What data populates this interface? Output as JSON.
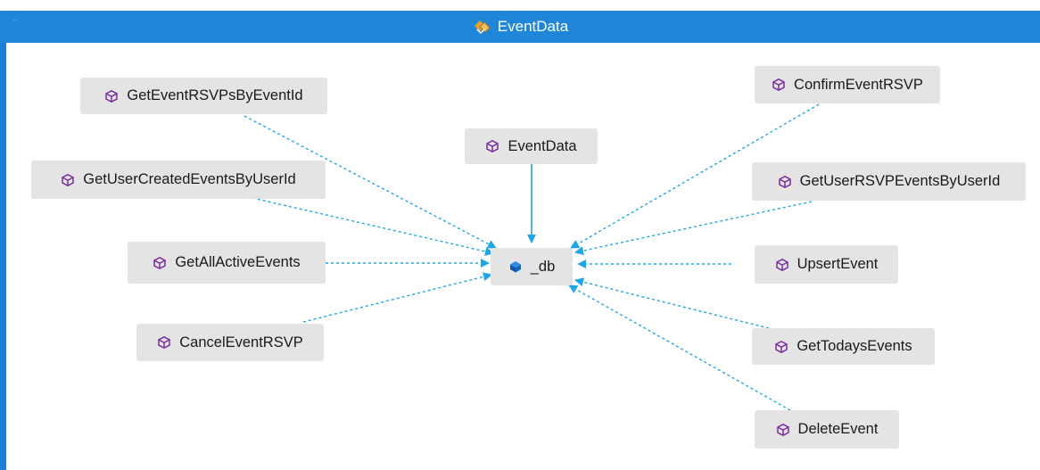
{
  "window": {
    "title": "EventData",
    "icon": "class-diagram-icon"
  },
  "colors": {
    "accent": "#1f86d8",
    "edge": "#1ea7e6",
    "node_fill": "#e4e4e4",
    "method_icon": "#7a2ea0",
    "field_icon": "#1466b8"
  },
  "center_node": {
    "label": "_db",
    "icon": "field-icon"
  },
  "nodes": [
    {
      "id": "GetEventRSVPsByEventId",
      "label": "GetEventRSVPsByEventId",
      "icon": "method-icon"
    },
    {
      "id": "GetUserCreatedEventsByUserId",
      "label": "GetUserCreatedEventsByUserId",
      "icon": "method-icon"
    },
    {
      "id": "GetAllActiveEvents",
      "label": "GetAllActiveEvents",
      "icon": "method-icon"
    },
    {
      "id": "CancelEventRSVP",
      "label": "CancelEventRSVP",
      "icon": "method-icon"
    },
    {
      "id": "EventData",
      "label": "EventData",
      "icon": "method-icon"
    },
    {
      "id": "ConfirmEventRSVP",
      "label": "ConfirmEventRSVP",
      "icon": "method-icon"
    },
    {
      "id": "GetUserRSVPEventsByUserId",
      "label": "GetUserRSVPEventsByUserId",
      "icon": "method-icon"
    },
    {
      "id": "UpsertEvent",
      "label": "UpsertEvent",
      "icon": "method-icon"
    },
    {
      "id": "GetTodaysEvents",
      "label": "GetTodaysEvents",
      "icon": "method-icon"
    },
    {
      "id": "DeleteEvent",
      "label": "DeleteEvent",
      "icon": "method-icon"
    }
  ],
  "edges": [
    {
      "from": "GetEventRSVPsByEventId",
      "to": "_db",
      "style": "dashed"
    },
    {
      "from": "GetUserCreatedEventsByUserId",
      "to": "_db",
      "style": "dashed"
    },
    {
      "from": "GetAllActiveEvents",
      "to": "_db",
      "style": "dashed"
    },
    {
      "from": "CancelEventRSVP",
      "to": "_db",
      "style": "dashed"
    },
    {
      "from": "EventData",
      "to": "_db",
      "style": "solid"
    },
    {
      "from": "ConfirmEventRSVP",
      "to": "_db",
      "style": "dashed"
    },
    {
      "from": "GetUserRSVPEventsByUserId",
      "to": "_db",
      "style": "dashed"
    },
    {
      "from": "UpsertEvent",
      "to": "_db",
      "style": "dashed"
    },
    {
      "from": "GetTodaysEvents",
      "to": "_db",
      "style": "dashed"
    },
    {
      "from": "DeleteEvent",
      "to": "_db",
      "style": "dashed"
    }
  ]
}
